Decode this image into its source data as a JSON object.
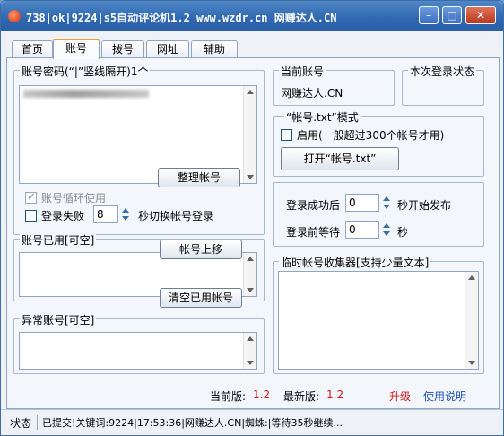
{
  "window": {
    "title": "738|ok|9224|s5自动评论机1.2 www.wzdr.cn 网赚达人.CN"
  },
  "tabs": [
    {
      "label": "首页"
    },
    {
      "label": "账号"
    },
    {
      "label": "拨号"
    },
    {
      "label": "网址"
    },
    {
      "label": "辅助"
    }
  ],
  "accounts": {
    "label": "账号密码(“|”竖线隔开)1个",
    "organize_button": "整理帐号",
    "loop_label": "账号循环使用",
    "login_fail_label": "登录失败",
    "login_fail_seconds": "8",
    "switch_label": "秒切换帐号登录"
  },
  "used_accounts": {
    "label": "账号已用[可空]",
    "move_up_button": "帐号上移",
    "clear_button": "清空已用帐号"
  },
  "abnormal_accounts": {
    "label": "异常账号[可空]"
  },
  "current_account": {
    "label": "当前账号",
    "value": "网赚达人.CN"
  },
  "login_status": {
    "label": "本次登录状态"
  },
  "txt_mode": {
    "label": "“帐号.txt”模式",
    "enable_label": "启用(一般超过300个帐号才用)",
    "open_button": "打开“帐号.txt”"
  },
  "timing": {
    "after_login_label": "登录成功后",
    "after_login_value": "0",
    "after_login_suffix": "秒开始发布",
    "before_login_label": "登录前等待",
    "before_login_value": "0",
    "before_login_suffix": "秒"
  },
  "collector": {
    "label": "临时帐号收集器[支持少量文本]"
  },
  "versions": {
    "current_label": "当前版:",
    "current_value": "1.2",
    "latest_label": "最新版:",
    "latest_value": "1.2",
    "upgrade_link": "升级",
    "help_link": "使用说明"
  },
  "status": {
    "label": "状态",
    "text": "已提交!关键词:9224|17:53:36|网赚达人.CN|蜘蛛:|等待35秒继续..."
  },
  "colors": {
    "titlebar": "#2e67b0",
    "accent_red": "#d21b1b",
    "link_blue": "#1a4fb8"
  }
}
